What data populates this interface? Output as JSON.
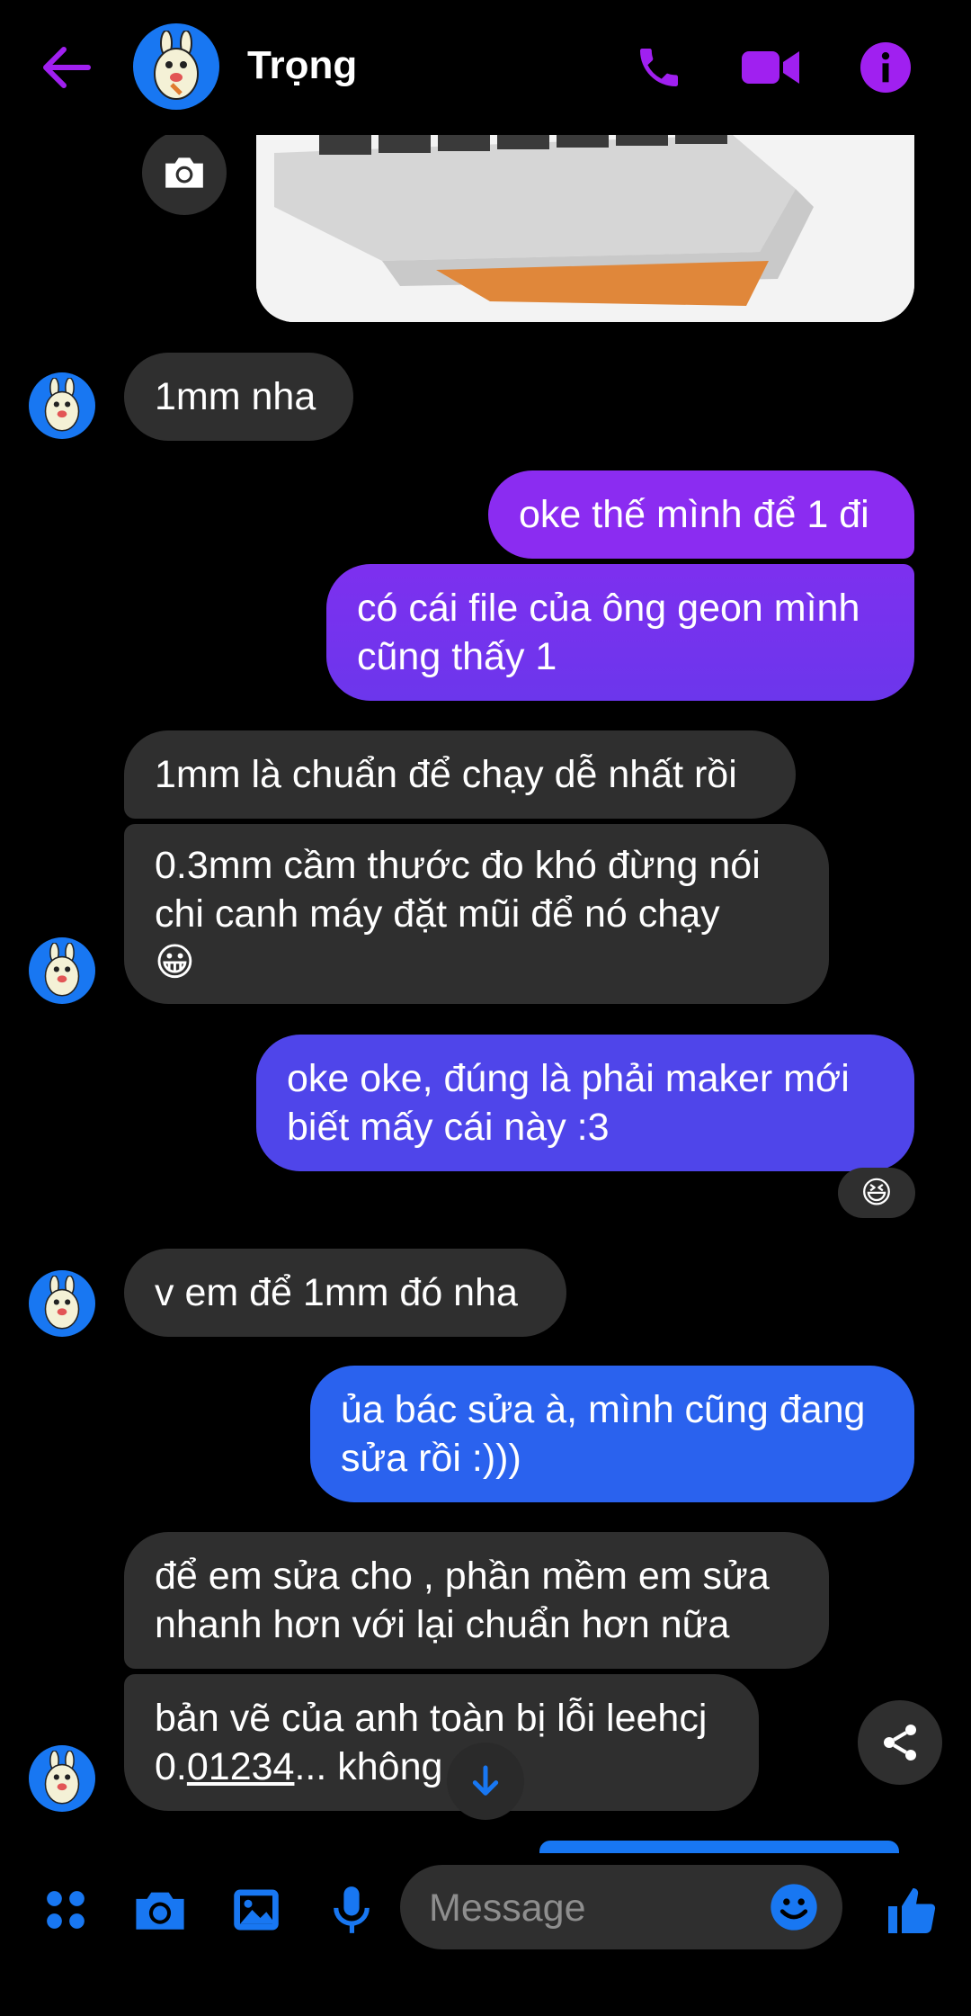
{
  "colors": {
    "accent_purple": "#a020f0",
    "brand_blue": "#1877f2",
    "incoming_bubble": "#2f2f2f"
  },
  "header": {
    "contact_name": "Trọng",
    "icons": [
      "back-arrow-icon",
      "phone-icon",
      "video-camera-icon",
      "info-icon"
    ]
  },
  "messages": [
    {
      "id": "m1",
      "side": "in",
      "text": "1mm nha"
    },
    {
      "id": "m2",
      "side": "out",
      "text": "oke thế mình để 1 đi"
    },
    {
      "id": "m3a",
      "side": "out",
      "text": "có cái file của ông geon mình"
    },
    {
      "id": "m3b",
      "side": "out",
      "text": "cũng thấy 1"
    },
    {
      "id": "m4",
      "side": "in",
      "text": "1mm là chuẩn để chạy dễ nhất rồi"
    },
    {
      "id": "m5a",
      "side": "in",
      "text": "0.3mm cầm thước đo khó đừng nói"
    },
    {
      "id": "m5b",
      "side": "in",
      "text": "chi canh máy đặt mũi để nó chạy"
    },
    {
      "id": "m5c",
      "side": "in",
      "text": "😀"
    },
    {
      "id": "m6a",
      "side": "out",
      "text": "oke oke, đúng là phải maker mới"
    },
    {
      "id": "m6b",
      "side": "out",
      "text": "biết mấy cái này :3"
    },
    {
      "id": "m6_reaction",
      "text": "😆"
    },
    {
      "id": "m7",
      "side": "in",
      "text": "v em để 1mm đó nha"
    },
    {
      "id": "m8a",
      "side": "out",
      "text": "ủa bác sửa à, mình cũng đang"
    },
    {
      "id": "m8b",
      "side": "out",
      "text": "sửa rồi :)))"
    },
    {
      "id": "m9a",
      "side": "in",
      "text": "để em sửa cho , phần mềm em sửa"
    },
    {
      "id": "m9b",
      "side": "in",
      "text": "nhanh hơn với lại chuẩn hơn nữa"
    },
    {
      "id": "m10a",
      "side": "in",
      "text": "bản vẽ của anh toàn bị lỗi leehcj"
    },
    {
      "id": "m10b_pre",
      "side": "in",
      "text": "0."
    },
    {
      "id": "m10b_link",
      "side": "in",
      "text": "01234"
    },
    {
      "id": "m10b_post",
      "side": "in",
      "text": "... không"
    },
    {
      "id": "m10b_tail",
      "side": "in",
      "text": "v"
    }
  ],
  "composer": {
    "placeholder": "Message",
    "icons": [
      "menu-dots-icon",
      "camera-icon",
      "gallery-icon",
      "microphone-icon",
      "emoji-icon",
      "thumbs-up-icon"
    ]
  }
}
